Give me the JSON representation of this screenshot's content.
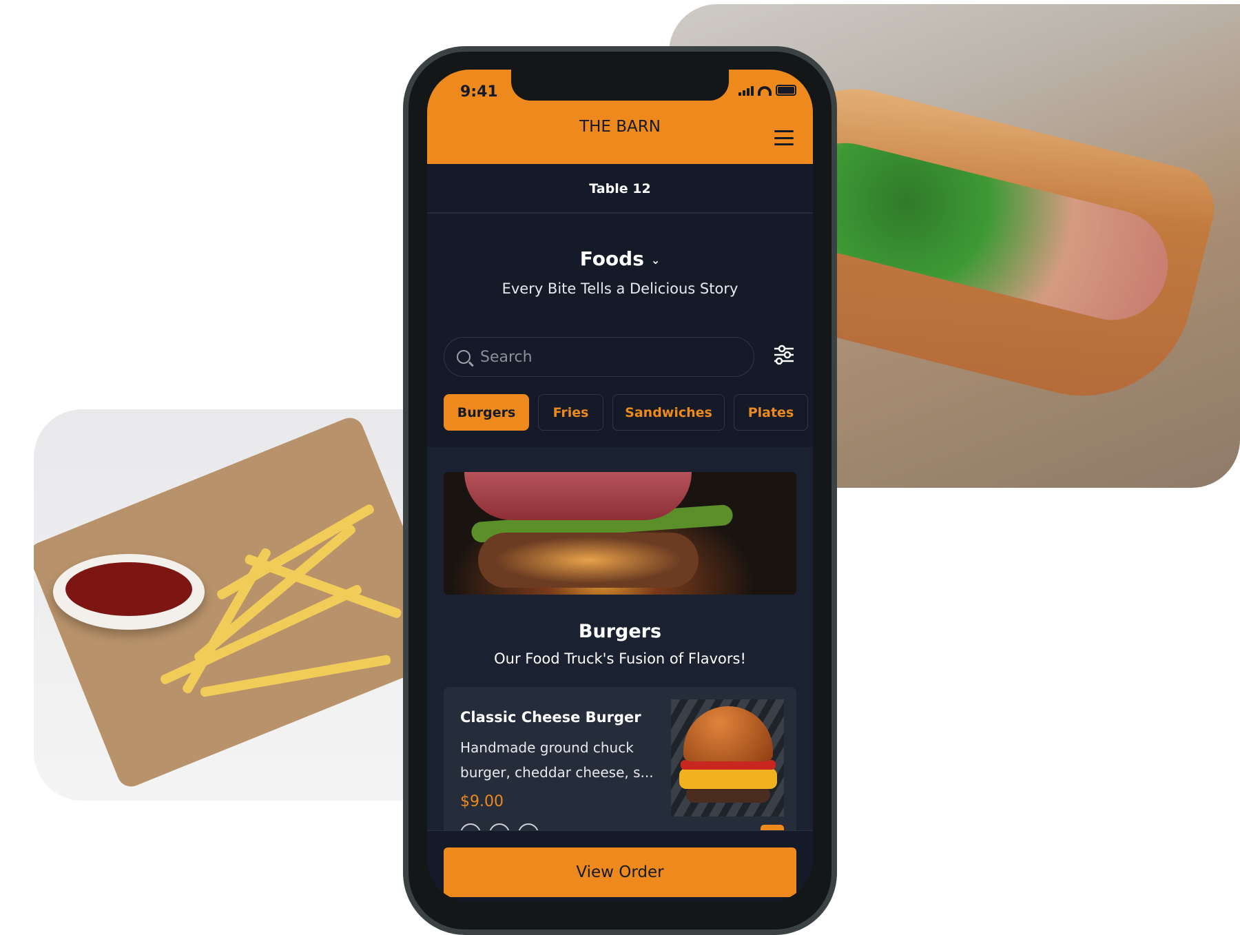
{
  "status_bar": {
    "time": "9:41"
  },
  "header": {
    "title": "THE BARN",
    "menu_icon": "hamburger-menu-icon"
  },
  "table": {
    "label": "Table 12"
  },
  "category_selector": {
    "label": "Foods",
    "tagline": "Every Bite Tells a Delicious Story"
  },
  "search": {
    "placeholder": "Search",
    "value": ""
  },
  "chips": [
    {
      "label": "Burgers",
      "active": true
    },
    {
      "label": "Fries"
    },
    {
      "label": "Sandwiches"
    },
    {
      "label": "Plates"
    }
  ],
  "section": {
    "title": "Burgers",
    "subtitle": "Our Food Truck's Fusion of Flavors!"
  },
  "items": [
    {
      "name": "Classic Cheese Burger",
      "description": "Handmade ground chuck burger, cheddar cheese, s...",
      "price": "$9.00"
    }
  ],
  "footer": {
    "view_order_label": "View Order"
  },
  "colors": {
    "accent": "#ee8a1d",
    "background": "#141a28",
    "card": "#252c3a"
  }
}
